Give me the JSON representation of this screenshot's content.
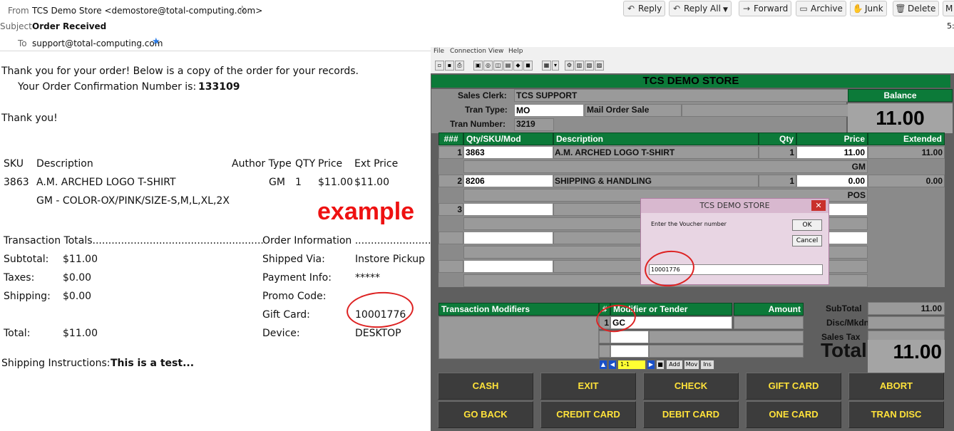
{
  "email": {
    "from_label": "From",
    "from_value": "TCS Demo Store <demostore@total-computing.com>",
    "subject_label": "Subject",
    "subject_value": "Order Received",
    "to_label": "To",
    "to_value": "support@total-computing.com",
    "toolbar": {
      "reply": "Reply",
      "reply_all": "Reply All",
      "forward": "Forward",
      "archive": "Archive",
      "junk": "Junk",
      "delete": "Delete",
      "more": "M"
    },
    "time_fragment": "5:",
    "body": {
      "thanks_line": "Thank you for your order! Below is a copy of the order for your records.",
      "confirmation_label": "Your Order Confirmation Number is:",
      "confirmation_number": "133109",
      "thank_you": "Thank you!",
      "table_headers": {
        "sku": "SKU",
        "description": "Description",
        "author_type": "Author Type",
        "qty": "QTY",
        "price": "Price",
        "ext_price": "Ext Price"
      },
      "item": {
        "sku": "3863",
        "description": "A.M. ARCHED LOGO T-SHIRT",
        "type": "GM",
        "qty": "1",
        "price": "$11.00",
        "ext_price": "$11.00",
        "options": "GM - COLOR-OX/PINK/SIZE-S,M,L,XL,2X"
      },
      "annotation": "example",
      "transaction_totals": "Transaction Totals......................................................",
      "order_information": "Order Information .........................",
      "subtotal_label": "Subtotal:",
      "subtotal_value": "$11.00",
      "taxes_label": "Taxes:",
      "taxes_value": "$0.00",
      "shipping_label": "Shipping:",
      "shipping_value": "$0.00",
      "total_label": "Total:",
      "total_value": "$11.00",
      "shipped_via_label": "Shipped Via:",
      "shipped_via_value": "Instore Pickup",
      "payment_label": "Payment Info:",
      "payment_value": "*****",
      "promo_label": "Promo Code:",
      "gift_card_label": "Gift Card:",
      "gift_card_value": "10001776",
      "device_label": "Device:",
      "device_value": "DESKTOP",
      "instructions_label": "Shipping Instructions:",
      "instructions_value": "This is a test..."
    }
  },
  "pos": {
    "menu": [
      "File",
      "Connection",
      "View",
      "Help"
    ],
    "store_title": "TCS DEMO STORE",
    "sales_clerk_label": "Sales Clerk:",
    "sales_clerk_value": "TCS SUPPORT",
    "tran_type_label": "Tran Type:",
    "tran_type_value": "MO",
    "tran_type_desc": "Mail Order Sale",
    "tran_number_label": "Tran Number:",
    "tran_number_value": "3219",
    "balance_label": "Balance",
    "balance_value": "11.00",
    "grid_headers": {
      "num": "###",
      "sku": "Qty/SKU/Mod",
      "description": "Description",
      "qty": "Qty",
      "price": "Price",
      "extended": "Extended"
    },
    "lines": [
      {
        "num": "1",
        "sku": "3863",
        "description": "A.M. ARCHED LOGO T-SHIRT",
        "qty": "1",
        "price": "11.00",
        "extended": "11.00",
        "sub": "GM"
      },
      {
        "num": "2",
        "sku": "8206",
        "description": "SHIPPING & HANDLING",
        "qty": "1",
        "price": "0.00",
        "extended": "0.00",
        "sub": "POS"
      },
      {
        "num": "3"
      }
    ],
    "modifiers_header": "Transaction Modifiers",
    "tender_num_header": "#",
    "tender_header": "Modifier or Tender",
    "amount_header": "Amount",
    "tender_row": {
      "num": "1",
      "value": "GC"
    },
    "nav_position": "1-1",
    "nav_add": "Add",
    "nav_mov": "Mov",
    "nav_ins": "Ins",
    "subtotal_label": "SubTotal",
    "subtotal_value": "11.00",
    "disc_label": "Disc/Mkdn",
    "sales_tax_label": "Sales Tax",
    "total_label": "Total",
    "total_value": "11.00",
    "buttons": {
      "cash": "CASH",
      "exit": "EXIT",
      "check": "CHECK",
      "gift_card": "GIFT CARD",
      "abort": "ABORT",
      "go_back": "GO BACK",
      "credit_card": "CREDIT CARD",
      "debit_card": "DEBIT CARD",
      "one_card": "ONE CARD",
      "tran_disc": "TRAN DISC"
    },
    "dialog": {
      "title": "TCS DEMO STORE",
      "prompt": "Enter the Voucher number",
      "ok": "OK",
      "cancel": "Cancel",
      "value": "10001776"
    }
  },
  "colors": {
    "pos_green": "#0c7a39",
    "button_text": "#ffe23a",
    "annotation_red": "#dd2222"
  }
}
